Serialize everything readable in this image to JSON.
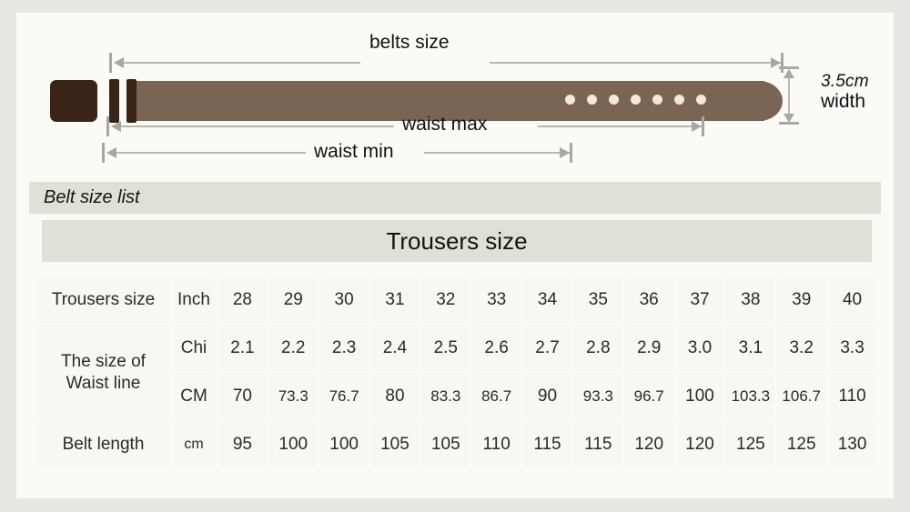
{
  "diagram": {
    "labels": {
      "belts_size": "belts size",
      "waist_max": "waist max",
      "waist_min": "waist min",
      "width_value": "3.5cm",
      "width_unit": "width"
    },
    "holes_count": 7
  },
  "bands": {
    "belt_size_list": "Belt size list",
    "trousers_size": "Trousers size"
  },
  "table": {
    "rows": [
      {
        "header": "Trousers size",
        "unit": "Inch",
        "values": [
          "28",
          "29",
          "30",
          "31",
          "32",
          "33",
          "34",
          "35",
          "36",
          "37",
          "38",
          "39",
          "40"
        ]
      },
      {
        "header": "The size of Waist line",
        "unit": "Chi",
        "values": [
          "2.1",
          "2.2",
          "2.3",
          "2.4",
          "2.5",
          "2.6",
          "2.7",
          "2.8",
          "2.9",
          "3.0",
          "3.1",
          "3.2",
          "3.3"
        ]
      },
      {
        "header": "",
        "unit": "CM",
        "values": [
          "70",
          "73.3",
          "76.7",
          "80",
          "83.3",
          "86.7",
          "90",
          "93.3",
          "96.7",
          "100",
          "103.3",
          "106.7",
          "110"
        ]
      },
      {
        "header": "Belt length",
        "unit": "cm",
        "values": [
          "95",
          "100",
          "100",
          "105",
          "105",
          "110",
          "115",
          "115",
          "120",
          "120",
          "125",
          "125",
          "130"
        ]
      }
    ],
    "waist_header_line1": "The size of",
    "waist_header_line2": "Waist line"
  },
  "colors": {
    "belt_body": "#7a6454",
    "buckle": "#3a2418",
    "hole": "#f2e9da",
    "band": "#e1e0d6",
    "panel": "#fbfaf7",
    "outer": "#e9e7e1",
    "cell": "#f7f7f3"
  }
}
